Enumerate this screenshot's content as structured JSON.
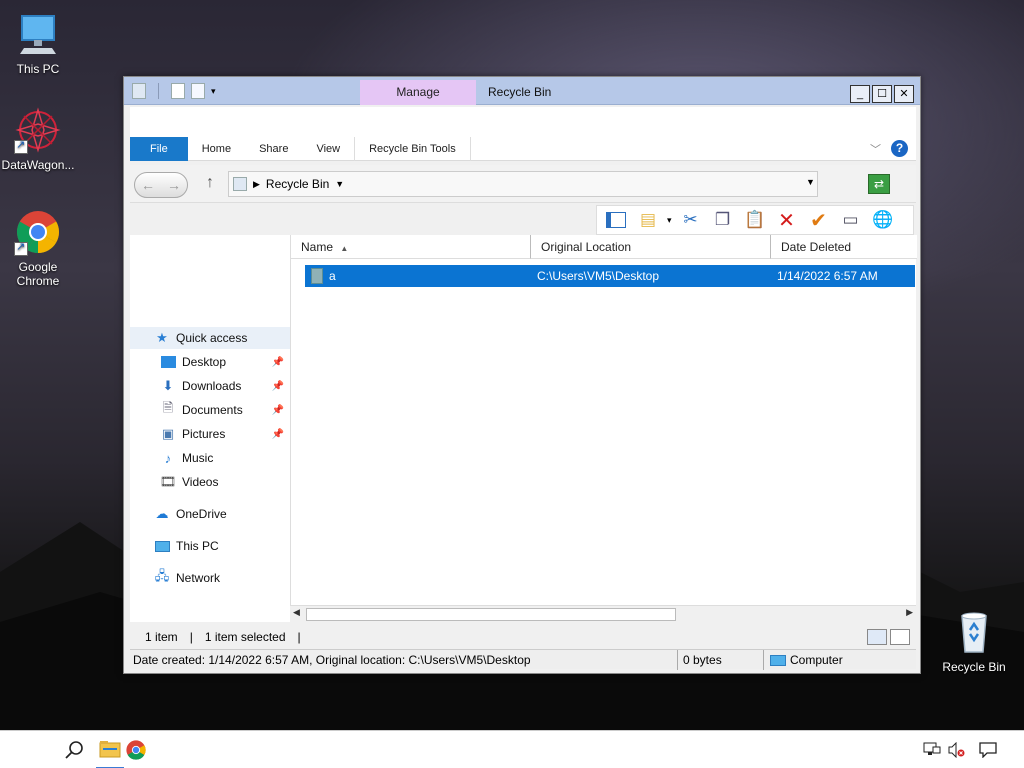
{
  "desktop": {
    "icons": [
      {
        "label": "This PC"
      },
      {
        "label": "DataWagon..."
      },
      {
        "label": "Google Chrome"
      },
      {
        "label": "Recycle Bin"
      }
    ]
  },
  "window": {
    "title": "Recycle Bin",
    "contextual_tab": "Manage",
    "ribbon_tabs": [
      "File",
      "Home",
      "Share",
      "View",
      "Recycle Bin Tools"
    ],
    "help_label": "?",
    "address": {
      "path": "Recycle Bin"
    },
    "nav": {
      "quick_access": "Quick access",
      "items": [
        {
          "label": "Desktop"
        },
        {
          "label": "Downloads"
        },
        {
          "label": "Documents"
        },
        {
          "label": "Pictures"
        },
        {
          "label": "Music"
        },
        {
          "label": "Videos"
        }
      ],
      "onedrive": "OneDrive",
      "this_pc": "This PC",
      "network": "Network"
    },
    "columns": [
      "Name",
      "Original Location",
      "Date Deleted"
    ],
    "rows": [
      {
        "name": "a",
        "location": "C:\\Users\\VM5\\Desktop",
        "date": "1/14/2022 6:57 AM"
      }
    ],
    "status": {
      "count": "1 item",
      "selected": "1 item selected",
      "details": "Date created: 1/14/2022 6:57 AM, Original location: C:\\Users\\VM5\\Desktop",
      "size": "0 bytes",
      "zone": "Computer"
    }
  },
  "colors": {
    "accent": "#0b74d2",
    "file_tab": "#1979ca",
    "manage_tab": "#e5c6f5",
    "titlebar": "#b6c8e8"
  }
}
